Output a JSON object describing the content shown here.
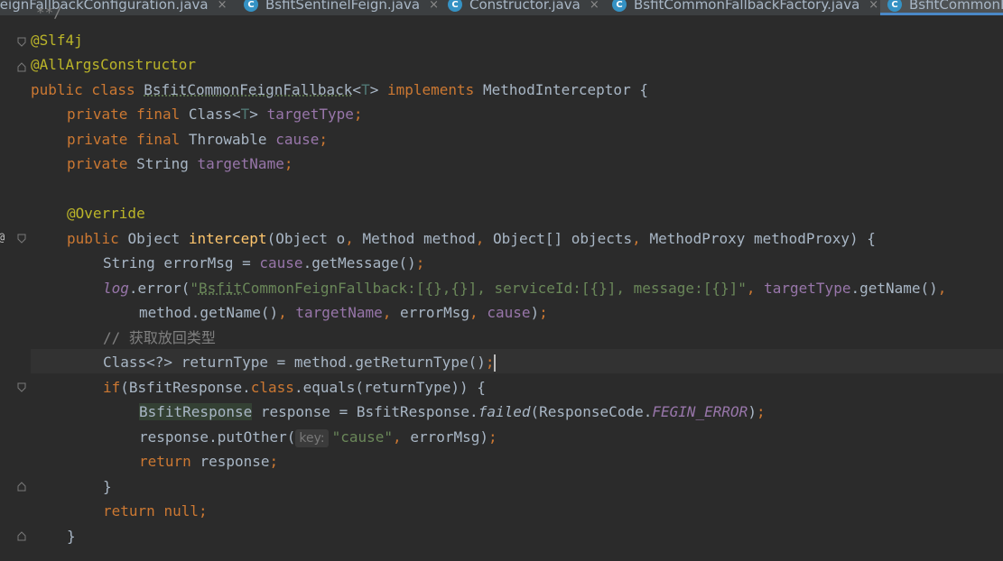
{
  "tabs": [
    {
      "label": "FeignFallbackConfiguration.java",
      "close": "×"
    },
    {
      "label": "BsfitSentinelFeign.java",
      "close": "×"
    },
    {
      "label": "Constructor.java",
      "close": "×"
    },
    {
      "label": "BsfitCommonFallbackFactory.java",
      "close": "×"
    },
    {
      "label": "BsfitCommonF"
    }
  ],
  "code": {
    "l0": "**/",
    "l1": "@Slf4j",
    "l2": "@AllArgsConstructor",
    "l3": {
      "a": "public class ",
      "b": "BsfitCommonFeignFallback",
      "c": "<",
      "d": "T",
      "e": "> ",
      "f": "implements ",
      "g": "MethodInterceptor {"
    },
    "l4": {
      "a": "private final ",
      "b": "Class<",
      "c": "T",
      "d": "> ",
      "e": "targetType",
      ";": ";"
    },
    "l5": {
      "a": "private final ",
      "b": "Throwable ",
      "c": "cause",
      ";": ";"
    },
    "l6": {
      "a": "private ",
      "b": "String ",
      "c": "targetName",
      ";": ";"
    },
    "l8": "@Override",
    "l9": {
      "a": "public ",
      "b": "Object ",
      "c": "intercept",
      "d": "(Object o",
      "e": ", ",
      "f": "Method method",
      "g": ", ",
      "h": "Object[] objects",
      "i": ", ",
      "j": "MethodProxy methodProxy) {"
    },
    "l10": {
      "a": "String errorMsg = ",
      "b": "cause",
      ".": ".getMessage()",
      ";": ";"
    },
    "l11": {
      "a": "log",
      ".": ".error(",
      "q": "\"",
      "u": "Bsfit",
      "s": "CommonFeignFallback:[{},{}], serviceId:[{}], message:[{}]\"",
      "c1": ", ",
      "f": "targetType",
      ".2": ".getName()",
      "c2": ","
    },
    "l12": {
      "a": "method.getName()",
      "c1": ", ",
      "b": "targetName",
      "c2": ", ",
      "c": "errorMsg",
      "c3": ", ",
      "d": "cause",
      ")": ")",
      ";": ";"
    },
    "l13": "// 获取放回类型",
    "l14": {
      "a": "Class<?> returnType = method.getReturnType()",
      ";": ";"
    },
    "l15": {
      "a": "if",
      "b": "(BsfitResponse.",
      "c": "class",
      ".": ".equals(returnType)) {"
    },
    "l16": {
      "a": "BsfitResponse",
      "b": " response = BsfitResponse.",
      "c": "failed",
      "d": "(ResponseCode.",
      "e": "FEGIN_ERROR",
      ")": ")",
      ";": ";"
    },
    "l17": {
      "a": "response.putOther(",
      "hint": "key:",
      "s": "\"cause\"",
      "c": ", ",
      "d": "errorMsg)",
      ";": ";"
    },
    "l18": {
      "a": "return ",
      "b": "response",
      ";": ";"
    },
    "l19": "}",
    "l20": {
      "a": "return ",
      "b": "null",
      ";": ";"
    },
    "l21": "}"
  }
}
